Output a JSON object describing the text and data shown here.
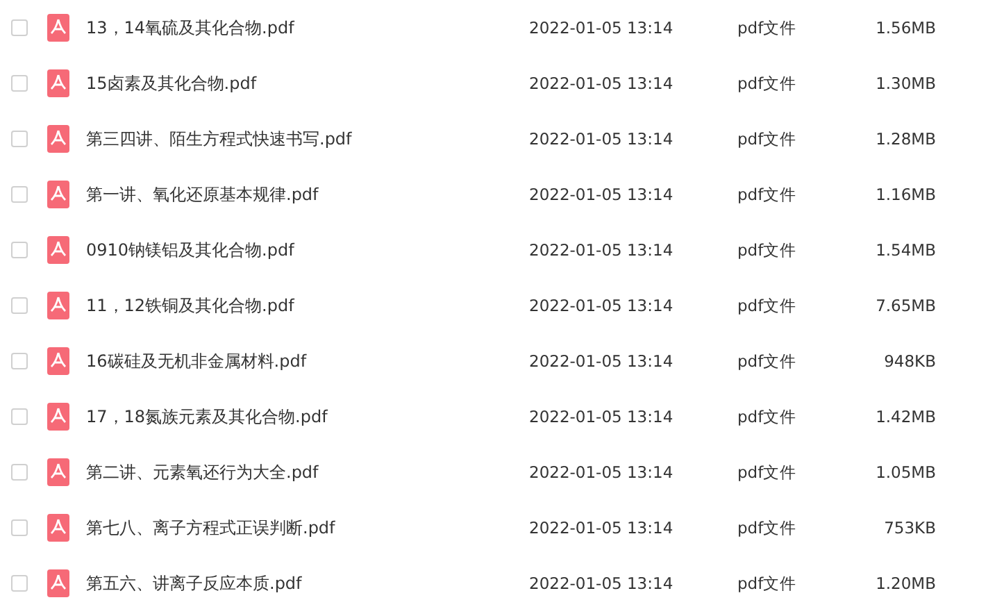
{
  "files": [
    {
      "name": "13，14氧硫及其化合物.pdf",
      "date": "2022-01-05 13:14",
      "type": "pdf文件",
      "size": "1.56MB",
      "checked": false
    },
    {
      "name": "15卤素及其化合物.pdf",
      "date": "2022-01-05 13:14",
      "type": "pdf文件",
      "size": "1.30MB",
      "checked": false
    },
    {
      "name": "第三四讲、陌生方程式快速书写.pdf",
      "date": "2022-01-05 13:14",
      "type": "pdf文件",
      "size": "1.28MB",
      "checked": false
    },
    {
      "name": "第一讲、氧化还原基本规律.pdf",
      "date": "2022-01-05 13:14",
      "type": "pdf文件",
      "size": "1.16MB",
      "checked": false
    },
    {
      "name": "0910钠镁铝及其化合物.pdf",
      "date": "2022-01-05 13:14",
      "type": "pdf文件",
      "size": "1.54MB",
      "checked": false
    },
    {
      "name": "11，12铁铜及其化合物.pdf",
      "date": "2022-01-05 13:14",
      "type": "pdf文件",
      "size": "7.65MB",
      "checked": false
    },
    {
      "name": "16碳硅及无机非金属材料.pdf",
      "date": "2022-01-05 13:14",
      "type": "pdf文件",
      "size": "948KB",
      "checked": false
    },
    {
      "name": "17，18氮族元素及其化合物.pdf",
      "date": "2022-01-05 13:14",
      "type": "pdf文件",
      "size": "1.42MB",
      "checked": false
    },
    {
      "name": "第二讲、元素氧还行为大全.pdf",
      "date": "2022-01-05 13:14",
      "type": "pdf文件",
      "size": "1.05MB",
      "checked": false
    },
    {
      "name": "第七八、离子方程式正误判断.pdf",
      "date": "2022-01-05 13:14",
      "type": "pdf文件",
      "size": "753KB",
      "checked": false
    },
    {
      "name": "第五六、讲离子反应本质.pdf",
      "date": "2022-01-05 13:14",
      "type": "pdf文件",
      "size": "1.20MB",
      "checked": false
    }
  ]
}
